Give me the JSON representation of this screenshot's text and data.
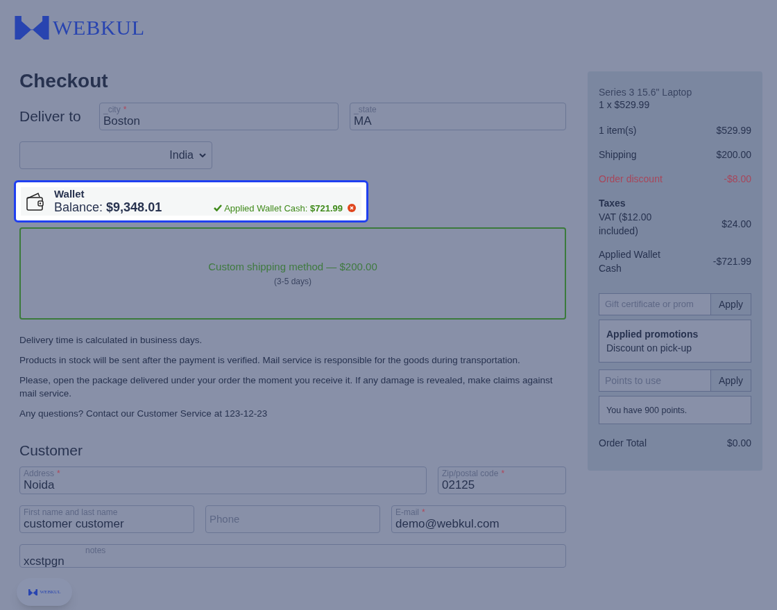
{
  "logo": {
    "text": "WEBKUL"
  },
  "title": "Checkout",
  "deliver": {
    "heading": "Deliver to",
    "city": {
      "label": "_city",
      "required_mark": "*",
      "value": "Boston"
    },
    "state": {
      "label": "_state",
      "value": "MA"
    },
    "country": "India"
  },
  "wallet": {
    "title": "Wallet",
    "balance_label": "Balance:",
    "balance": "$9,348.01",
    "applied_label": "Applied Wallet Cash:",
    "applied": "$721.99",
    "highlighted": true
  },
  "shipping": {
    "name": "Custom shipping method — $200.00",
    "time": "(3-5 days)",
    "selected": true
  },
  "notes": [
    "Delivery time is calculated in business days.",
    "Products in stock will be sent after the payment is verified. Mail service is responsible for the goods during transportation.",
    "Please, open the package delivered under your order the moment you receive it. If any damage is revealed, make claims against mail service.",
    "Any questions? Contact our Customer Service at 123-12-23"
  ],
  "customer": {
    "heading": "Customer",
    "address": {
      "label": "Address",
      "required_mark": "*",
      "value": "Noida"
    },
    "zip": {
      "label": "Zip/postal code",
      "required_mark": "*",
      "value": "02125"
    },
    "name": {
      "label": "First name and last name",
      "value": "customer customer"
    },
    "phone": {
      "placeholder": "Phone"
    },
    "email": {
      "label": "E-mail",
      "required_mark": "*",
      "value": "demo@webkul.com"
    },
    "notes": {
      "label": "notes",
      "value": "xcstpgn"
    }
  },
  "floating_button": {
    "text": "WEBKUL"
  },
  "summary": {
    "product": "Series 3 15.6\" Laptop",
    "quantity": "1 x $529.99",
    "lines": [
      {
        "label": "1 item(s)",
        "value": "$529.99",
        "kind": "plain"
      },
      {
        "label": "Shipping",
        "value": "$200.00",
        "kind": "plain"
      },
      {
        "label": "Order discount",
        "value": "-$8.00",
        "kind": "discount"
      }
    ],
    "taxes_heading": "Taxes",
    "tax_lines": [
      {
        "label": "VAT ($12.00 included)",
        "value": "$24.00"
      },
      {
        "label": "Applied Wallet Cash",
        "value": "-$721.99"
      }
    ],
    "promo": {
      "placeholder": "Gift certificate or prom",
      "button": "Apply",
      "note_title": "Applied promotions",
      "note_text": "Discount on pick-up"
    },
    "points": {
      "placeholder": "Points to use",
      "button": "Apply",
      "note_text": "You have 900 points."
    },
    "total_label": "Order Total",
    "total": "$0.00"
  }
}
